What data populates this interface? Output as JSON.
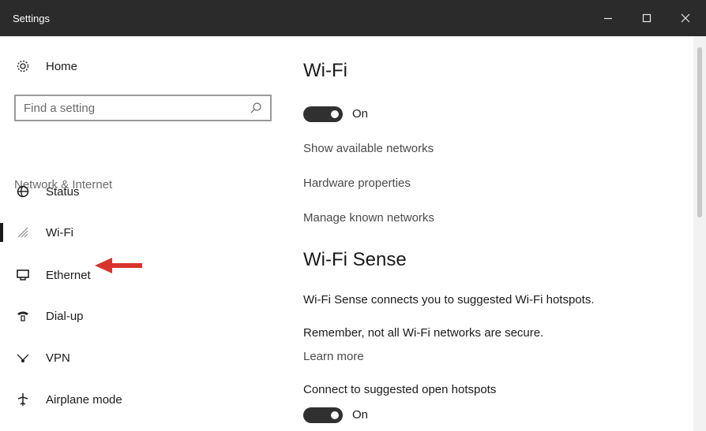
{
  "window": {
    "title": "Settings"
  },
  "sidebar": {
    "home_label": "Home",
    "search_placeholder": "Find a setting",
    "section_heading": "Network & Internet",
    "items": [
      {
        "label": "Status",
        "icon": "globe-icon"
      },
      {
        "label": "Wi-Fi",
        "icon": "wifi-icon",
        "active": true
      },
      {
        "label": "Ethernet",
        "icon": "ethernet-icon"
      },
      {
        "label": "Dial-up",
        "icon": "phone-icon"
      },
      {
        "label": "VPN",
        "icon": "vpn-icon"
      },
      {
        "label": "Airplane mode",
        "icon": "airplane-icon"
      }
    ]
  },
  "main": {
    "title": "Wi-Fi",
    "wifi_toggle_label": "On",
    "links": [
      "Show available networks",
      "Hardware properties",
      "Manage known networks"
    ],
    "sense": {
      "title": "Wi-Fi Sense",
      "description": "Wi-Fi Sense connects you to suggested Wi-Fi hotspots.",
      "warning": "Remember, not all Wi-Fi networks are secure.",
      "learn_more": "Learn more",
      "hotspots_label": "Connect to suggested open hotspots",
      "hotspots_toggle_label": "On"
    }
  },
  "colors": {
    "titlebar": "#2b2b2b",
    "toggle_on": "#303030",
    "annotation_arrow": "#d9342b"
  }
}
